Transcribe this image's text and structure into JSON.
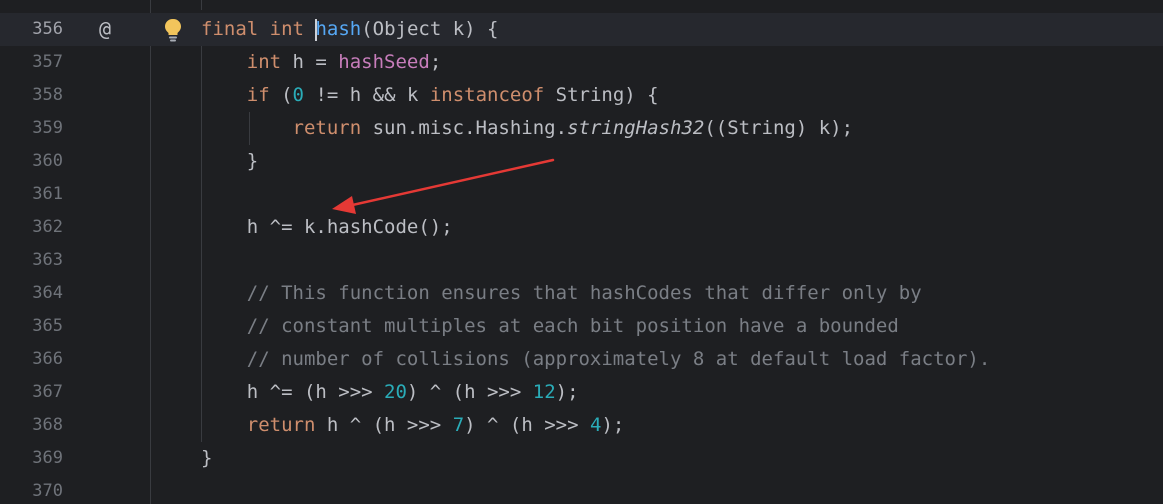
{
  "editor": {
    "lines": [
      {
        "number": "356",
        "tokens": [
          {
            "t": "final",
            "c": "kw"
          },
          {
            "t": " "
          },
          {
            "t": "int",
            "c": "kw"
          },
          {
            "t": " "
          },
          {
            "t": "hash",
            "c": "fn",
            "caret": true
          },
          {
            "t": "(Object k) {"
          }
        ]
      },
      {
        "number": "357",
        "tokens": [
          {
            "t": "    "
          },
          {
            "t": "int",
            "c": "kw"
          },
          {
            "t": " h = "
          },
          {
            "t": "hashSeed",
            "c": "field"
          },
          {
            "t": ";"
          }
        ]
      },
      {
        "number": "358",
        "tokens": [
          {
            "t": "    "
          },
          {
            "t": "if",
            "c": "kw"
          },
          {
            "t": " ("
          },
          {
            "t": "0",
            "c": "num"
          },
          {
            "t": " != h && k "
          },
          {
            "t": "instanceof",
            "c": "kw"
          },
          {
            "t": " String) {"
          }
        ]
      },
      {
        "number": "359",
        "tokens": [
          {
            "t": "        "
          },
          {
            "t": "return",
            "c": "kw"
          },
          {
            "t": " sun.misc.Hashing."
          },
          {
            "t": "stringHash32",
            "c": "ital"
          },
          {
            "t": "((String) k);"
          }
        ]
      },
      {
        "number": "360",
        "tokens": [
          {
            "t": "    }"
          }
        ]
      },
      {
        "number": "361",
        "tokens": []
      },
      {
        "number": "362",
        "tokens": [
          {
            "t": "    h ^= k.hashCode();"
          }
        ]
      },
      {
        "number": "363",
        "tokens": []
      },
      {
        "number": "364",
        "tokens": [
          {
            "t": "    // This function ensures that hashCodes that differ only by",
            "c": "cmt"
          }
        ]
      },
      {
        "number": "365",
        "tokens": [
          {
            "t": "    // constant multiples at each bit position have a bounded",
            "c": "cmt"
          }
        ]
      },
      {
        "number": "366",
        "tokens": [
          {
            "t": "    // number of collisions (approximately 8 at default load factor).",
            "c": "cmt"
          }
        ]
      },
      {
        "number": "367",
        "tokens": [
          {
            "t": "    h ^= (h >>> "
          },
          {
            "t": "20",
            "c": "num"
          },
          {
            "t": ") ^ (h >>> "
          },
          {
            "t": "12",
            "c": "num"
          },
          {
            "t": ");"
          }
        ]
      },
      {
        "number": "368",
        "tokens": [
          {
            "t": "    "
          },
          {
            "t": "return",
            "c": "kw"
          },
          {
            "t": " h ^ (h >>> "
          },
          {
            "t": "7",
            "c": "num"
          },
          {
            "t": ") ^ (h >>> "
          },
          {
            "t": "4",
            "c": "num"
          },
          {
            "t": ");"
          }
        ]
      },
      {
        "number": "369",
        "tokens": [
          {
            "t": "}"
          }
        ]
      },
      {
        "number": "370",
        "tokens": []
      }
    ],
    "gutter_icons": {
      "override_marker": "@",
      "intention": "lightbulb-icon"
    },
    "colors": {
      "background": "#1e1f22",
      "keyword": "#cf8e6d",
      "function": "#56a8f5",
      "field": "#c77dbb",
      "number": "#2aacb8",
      "comment": "#7a7e85",
      "annotation_arrow": "#e53935"
    }
  }
}
